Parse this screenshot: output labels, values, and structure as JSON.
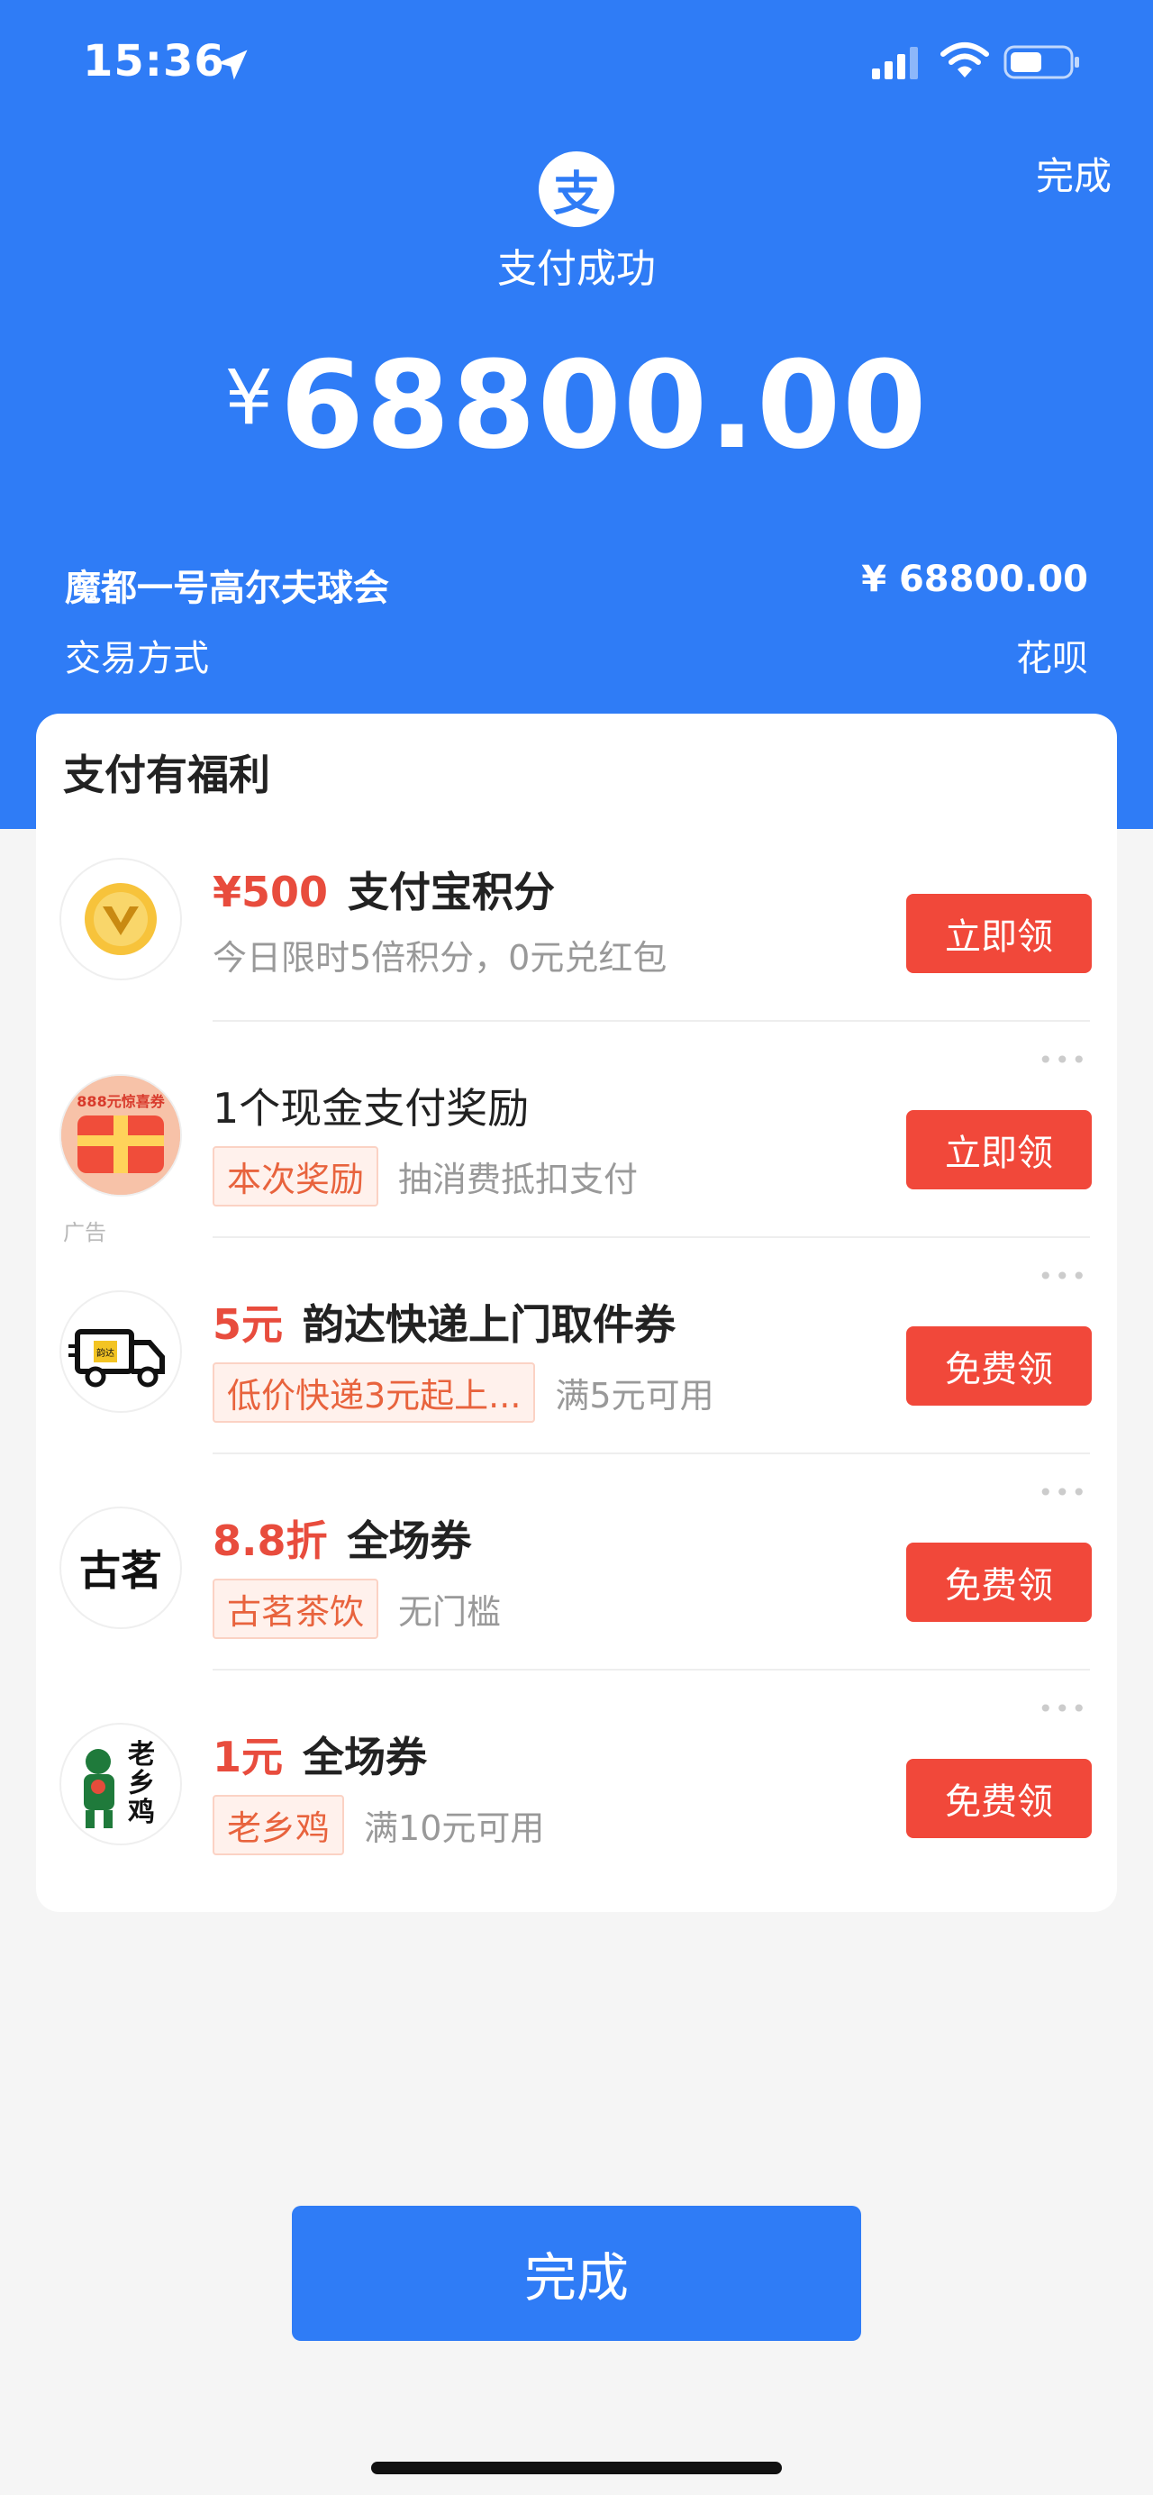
{
  "status_bar": {
    "time": "15:36"
  },
  "header": {
    "done_label": "完成",
    "title": "支付成功",
    "currency": "¥",
    "amount": "68800.00",
    "merchant": "魔都一号高尔夫球会",
    "merchant_amount": "¥ 68800.00",
    "pay_method_label": "交易方式",
    "pay_method_value": "花呗",
    "brand_color": "#2f7cf6"
  },
  "benefits": {
    "title": "支付有福利",
    "ad_label": "广告",
    "items": [
      {
        "highlight": "¥500",
        "name": "支付宝积分",
        "tag": "",
        "desc": "今日限时5倍积分，0元兑红包",
        "button": "立即领",
        "icon": "alipay-points-icon"
      },
      {
        "highlight": "",
        "name": "1个现金支付奖励",
        "tag": "本次奖励",
        "desc": "抽消费抵扣支付",
        "button": "立即领",
        "icon": "gift-coupon-icon",
        "icon_text": "888元惊喜券"
      },
      {
        "highlight": "5元",
        "name": "韵达快递上门取件券",
        "tag": "低价快递3元起上...",
        "desc": "满5元可用",
        "button": "免费领",
        "icon": "delivery-truck-icon",
        "icon_text": "韵达"
      },
      {
        "highlight": "8.8折",
        "name": "全场券",
        "tag": "古茗茶饮",
        "desc": "无门槛",
        "button": "免费领",
        "icon": "guming-logo",
        "icon_text": "古茗"
      },
      {
        "highlight": "1元",
        "name": "全场券",
        "tag": "老乡鸡",
        "desc": "满10元可用",
        "button": "免费领",
        "icon": "laoxiangji-logo",
        "icon_text": "老乡鸡"
      }
    ]
  },
  "footer": {
    "done_button": "完成"
  },
  "colors": {
    "accent_red": "#f1483a",
    "highlight_red": "#e84c3d"
  }
}
